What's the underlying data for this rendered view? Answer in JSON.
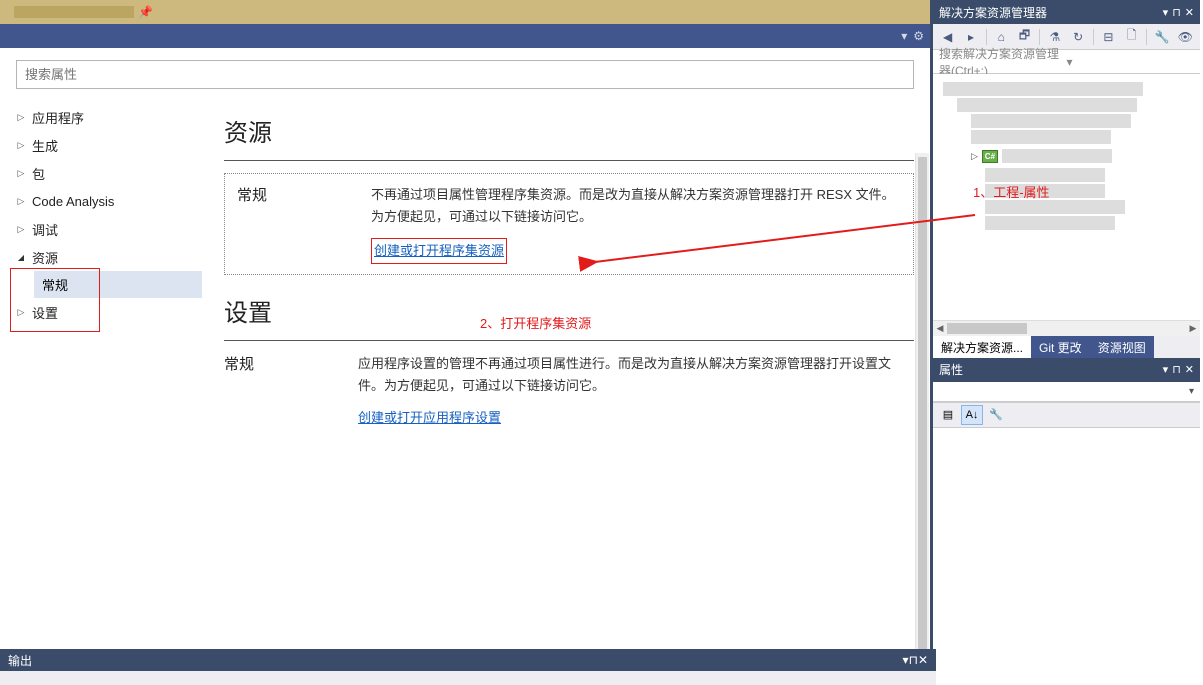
{
  "header": {
    "dropdown_icon": "▾",
    "gear_icon": "⚙"
  },
  "search": {
    "placeholder": "搜索属性"
  },
  "nav": {
    "items": [
      {
        "label": "应用程序"
      },
      {
        "label": "生成"
      },
      {
        "label": "包"
      },
      {
        "label": "Code Analysis"
      },
      {
        "label": "调试"
      },
      {
        "label": "资源",
        "expanded": true,
        "sub": "常规"
      },
      {
        "label": "设置"
      }
    ]
  },
  "content": {
    "resources": {
      "title": "资源",
      "general_label": "常规",
      "general_text": "不再通过项目属性管理程序集资源。而是改为直接从解决方案资源管理器打开 RESX 文件。为方便起见，可通过以下链接访问它。",
      "link": "创建或打开程序集资源"
    },
    "settings": {
      "title": "设置",
      "general_label": "常规",
      "general_text": "应用程序设置的管理不再通过项目属性进行。而是改为直接从解决方案资源管理器打开设置文件。为方便起见，可通过以下链接访问它。",
      "link": "创建或打开应用程序设置"
    }
  },
  "annotations": {
    "step1": "1、工程-属性",
    "step2": "2、打开程序集资源"
  },
  "solution_explorer": {
    "title": "解决方案资源管理器",
    "search_placeholder": "搜索解决方案资源管理器(Ctrl+;)",
    "cs_icon": "C#",
    "tabs": {
      "active": "解决方案资源...",
      "git": "Git 更改",
      "resview": "资源视图"
    }
  },
  "properties_panel": {
    "title": "属性"
  },
  "output_panel": {
    "title": "输出"
  }
}
